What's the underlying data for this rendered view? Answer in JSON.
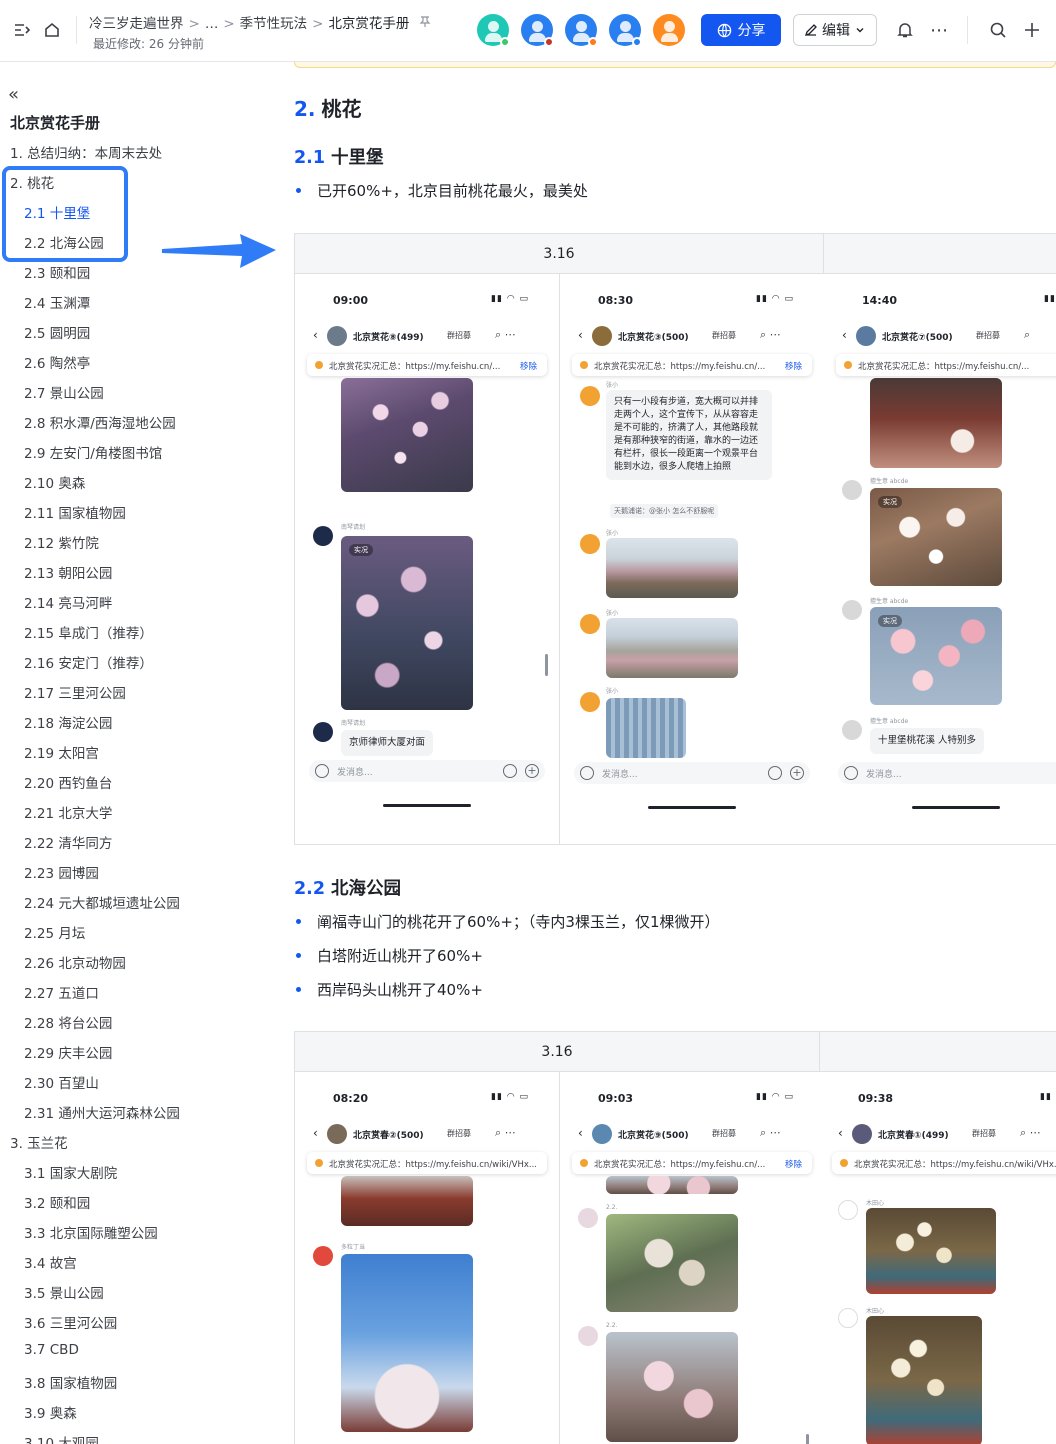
{
  "topbar": {
    "breadcrumb": [
      "冷三岁走遍世界",
      "…",
      "季节性玩法",
      "北京赏花手册"
    ],
    "separator": ">",
    "last_modified": "最近修改: 26 分钟前",
    "share_label": "分享",
    "edit_label": "编辑",
    "avatar_colors": [
      "#1ec8b4",
      "#2a7ff0",
      "#2a7ff0",
      "#2a7ff0",
      "#ff8a1f"
    ],
    "avatar_dot_colors": [
      "#3cc96b",
      "#c0392b",
      "#ff7a1a",
      "#2a7ff0",
      "#ffffff"
    ],
    "accent": "#1456f0"
  },
  "sidebar": {
    "title": "北京赏花手册",
    "items": [
      {
        "label": "1. 总结归纳：本周末去处",
        "level": 1,
        "active": false
      },
      {
        "label": "2. 桃花",
        "level": 1,
        "active": false
      },
      {
        "label": "2.1 十里堡",
        "level": 2,
        "active": true
      },
      {
        "label": "2.2 北海公园",
        "level": 2,
        "active": false
      },
      {
        "label": "2.3 颐和园",
        "level": 2,
        "active": false
      },
      {
        "label": "2.4 玉渊潭",
        "level": 2,
        "active": false
      },
      {
        "label": "2.5 圆明园",
        "level": 2,
        "active": false
      },
      {
        "label": "2.6 陶然亭",
        "level": 2,
        "active": false
      },
      {
        "label": "2.7 景山公园",
        "level": 2,
        "active": false
      },
      {
        "label": "2.8 积水潭/西海湿地公园",
        "level": 2,
        "active": false
      },
      {
        "label": "2.9 左安门/角楼图书馆",
        "level": 2,
        "active": false
      },
      {
        "label": "2.10 奥森",
        "level": 2,
        "active": false
      },
      {
        "label": "2.11 国家植物园",
        "level": 2,
        "active": false
      },
      {
        "label": "2.12 紫竹院",
        "level": 2,
        "active": false
      },
      {
        "label": "2.13 朝阳公园",
        "level": 2,
        "active": false
      },
      {
        "label": "2.14 亮马河畔",
        "level": 2,
        "active": false
      },
      {
        "label": "2.15 阜成门（推荐）",
        "level": 2,
        "active": false
      },
      {
        "label": "2.16 安定门（推荐）",
        "level": 2,
        "active": false
      },
      {
        "label": "2.17 三里河公园",
        "level": 2,
        "active": false
      },
      {
        "label": "2.18 海淀公园",
        "level": 2,
        "active": false
      },
      {
        "label": "2.19 太阳宫",
        "level": 2,
        "active": false
      },
      {
        "label": "2.20 西钓鱼台",
        "level": 2,
        "active": false
      },
      {
        "label": "2.21 北京大学",
        "level": 2,
        "active": false
      },
      {
        "label": "2.22 清华同方",
        "level": 2,
        "active": false
      },
      {
        "label": "2.23 园博园",
        "level": 2,
        "active": false
      },
      {
        "label": "2.24 元大都城垣遗址公园",
        "level": 2,
        "active": false
      },
      {
        "label": "2.25 月坛",
        "level": 2,
        "active": false
      },
      {
        "label": "2.26 北京动物园",
        "level": 2,
        "active": false
      },
      {
        "label": "2.27 五道口",
        "level": 2,
        "active": false
      },
      {
        "label": "2.28 将台公园",
        "level": 2,
        "active": false
      },
      {
        "label": "2.29 庆丰公园",
        "level": 2,
        "active": false
      },
      {
        "label": "2.30 百望山",
        "level": 2,
        "active": false
      },
      {
        "label": "2.31 通州大运河森林公园",
        "level": 2,
        "active": false
      },
      {
        "label": "3. 玉兰花",
        "level": 1,
        "active": false
      },
      {
        "label": "3.1 国家大剧院",
        "level": 2,
        "active": false
      },
      {
        "label": "3.2 颐和园",
        "level": 2,
        "active": false
      },
      {
        "label": "3.3 北京国际雕塑公园",
        "level": 2,
        "active": false
      },
      {
        "label": "3.4 故宫",
        "level": 2,
        "active": false
      },
      {
        "label": "3.5 景山公园",
        "level": 2,
        "active": false
      },
      {
        "label": "3.6 三里河公园",
        "level": 2,
        "active": false
      },
      {
        "label": "3.7 CBD",
        "level": 2,
        "active": false
      },
      {
        "label": "3.8 国家植物园",
        "level": 2,
        "active": false
      },
      {
        "label": "3.9 奥森",
        "level": 2,
        "active": false
      },
      {
        "label": "3.10 大观园",
        "level": 2,
        "active": false
      }
    ],
    "highlight_color": "#2f7cf6"
  },
  "doc": {
    "h2": {
      "num": "2.",
      "text": "桃花"
    },
    "s1": {
      "num": "2.1",
      "text": "十里堡",
      "bullets": [
        "已开60%+，北京目前桃花最火，最美处"
      ]
    },
    "s2": {
      "num": "2.2",
      "text": "北海公园",
      "bullets": [
        "阐福寺山门的桃花开了60%+；（寺内3棵玉兰，仅1棵微开）",
        "白塔附近山桃开了60%+",
        "西岸码头山桃开了40%+"
      ]
    },
    "gallery1": {
      "header": "3.16",
      "phones": [
        {
          "time": "09:00",
          "group": "北京赏花⑧(499)",
          "manager": "群招募",
          "pinned": "北京赏花实况汇总：https://my.feishu.cn/...",
          "remove": "移除",
          "sender": "南琴请划",
          "live": "实况",
          "caption": "京师律师大厦对面",
          "input": "发消息..."
        },
        {
          "time": "08:30",
          "group": "北京赏花③(500)",
          "manager": "群招募",
          "pinned": "北京赏花实况汇总：https://my.feishu.cn/...",
          "remove": "移除",
          "sender": "张小",
          "message": "只有一小段有步道，宽大概可以并排走两个人，这个宣传下，从从容容走是不可能的，挤满了人，其他路段就是有那种狭窄的街道，靠水的一边还有栏杆，很长一段距离一个观景平台能到水边，很多人爬墙上拍照",
          "reply": "天鹅浦诺：@张小 怎么不舒服呢",
          "input": "发消息..."
        },
        {
          "time": "14:40",
          "group": "北京赏花⑦(500)",
          "manager": "群招募",
          "pinned": "北京赏花实况汇总：https://my.feishu.cn/...",
          "remove": "移",
          "sender": "擅生意 abcde",
          "live": "实况",
          "caption": "十里堡桃花溪 人特别多",
          "input": "发消息..."
        }
      ]
    },
    "gallery2": {
      "header": "3.16",
      "phones": [
        {
          "time": "08:20",
          "group": "北京赏春②(500)",
          "manager": "群招募",
          "pinned": "北京赏花实况汇总：https://my.feishu.cn/wiki/VHx...",
          "sender": "多粒丁当"
        },
        {
          "time": "09:03",
          "group": "北京赏花⑨(500)",
          "manager": "群招募",
          "pinned": "北京赏花实况汇总：https://my.feishu.cn/...",
          "remove": "移除",
          "sender": "2.2."
        },
        {
          "time": "09:38",
          "group": "北京赏春①(499)",
          "manager": "群招募",
          "pinned": "北京赏花实况汇总：https://my.feishu.cn/wiki/VHx...",
          "sender": "木田心"
        }
      ]
    }
  }
}
